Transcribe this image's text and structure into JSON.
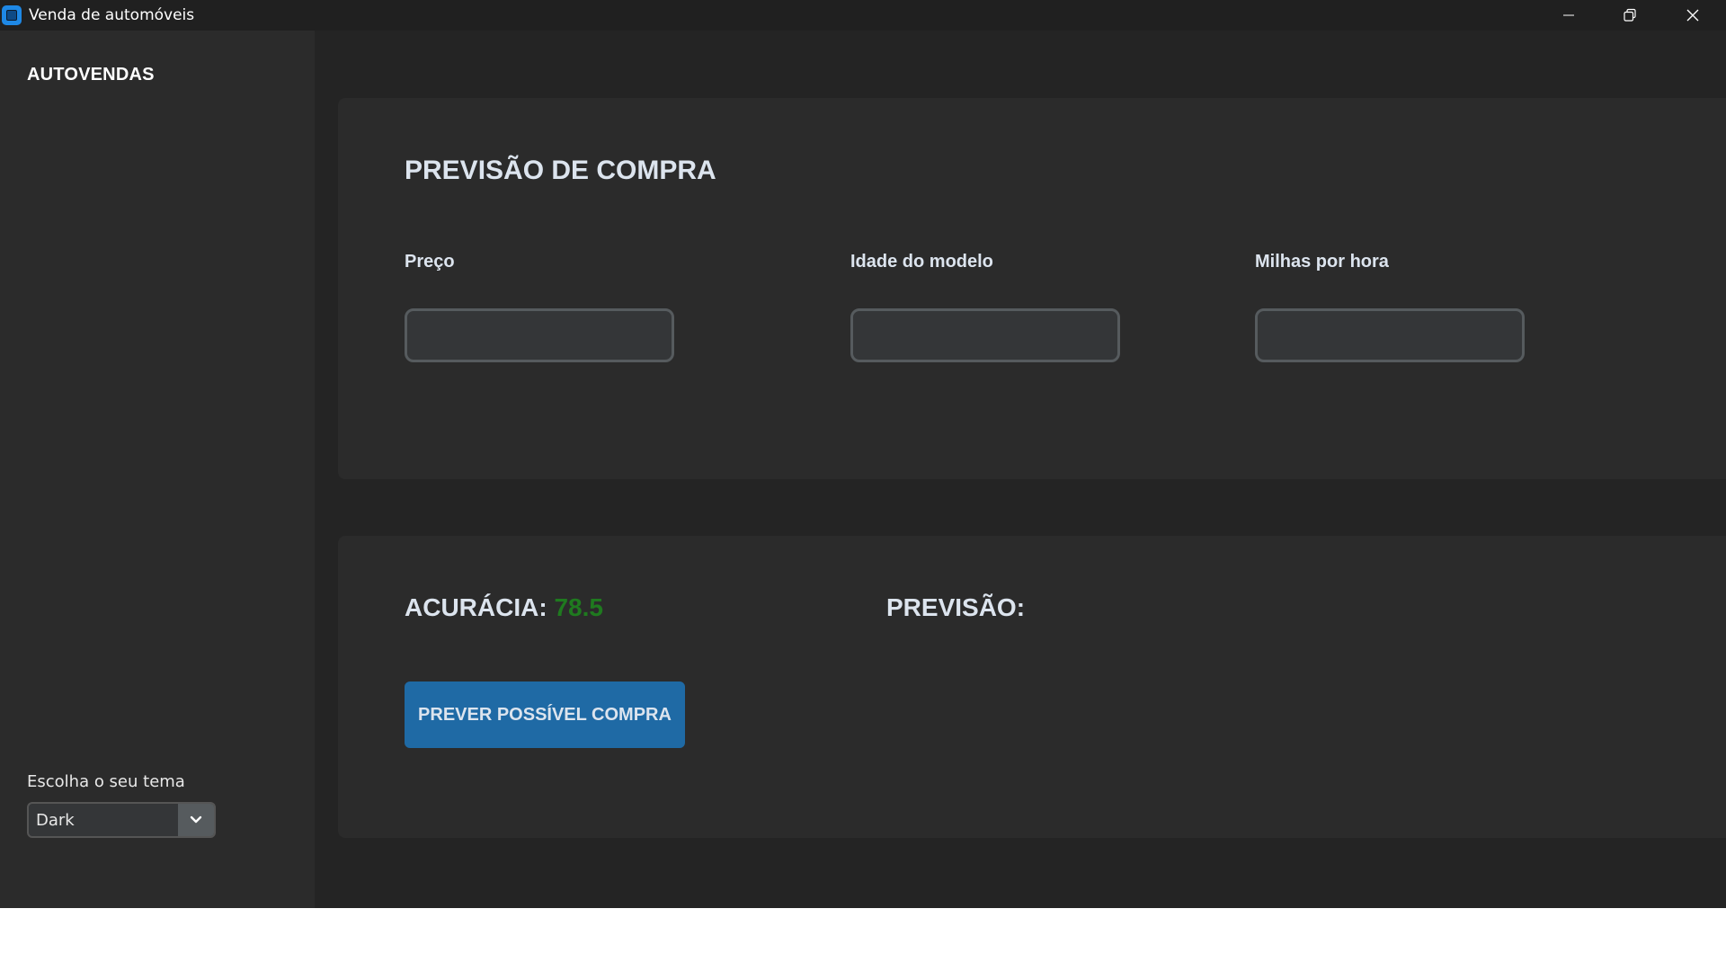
{
  "window": {
    "title": "Venda de automóveis",
    "icons": {
      "app": "app-icon",
      "minimize": "minimize-icon",
      "maximize": "restore-icon",
      "close": "close-icon"
    }
  },
  "sidebar": {
    "brand": "AUTOVENDAS",
    "theme": {
      "label": "Escolha o seu tema",
      "selected": "Dark",
      "arrow_icon": "chevron-down-icon"
    }
  },
  "form": {
    "title": "PREVISÃO DE COMPRA",
    "fields": [
      {
        "label": "Preço",
        "value": "",
        "placeholder": ""
      },
      {
        "label": "Idade do modelo",
        "value": "",
        "placeholder": ""
      },
      {
        "label": "Milhas por hora",
        "value": "",
        "placeholder": ""
      }
    ]
  },
  "result": {
    "accuracy_label": "ACURÁCIA:",
    "accuracy_value": "78.5",
    "prediction_label": "PREVISÃO:",
    "prediction_value": "",
    "button_label": "PREVER POSSÍVEL COMPRA"
  },
  "colors": {
    "window_bg": "#242424",
    "panel_bg": "#2b2b2b",
    "titlebar_bg": "#202020",
    "accent": "#1f6aa5",
    "accuracy_value": "#1f7a1f",
    "text": "#dce4ee"
  }
}
